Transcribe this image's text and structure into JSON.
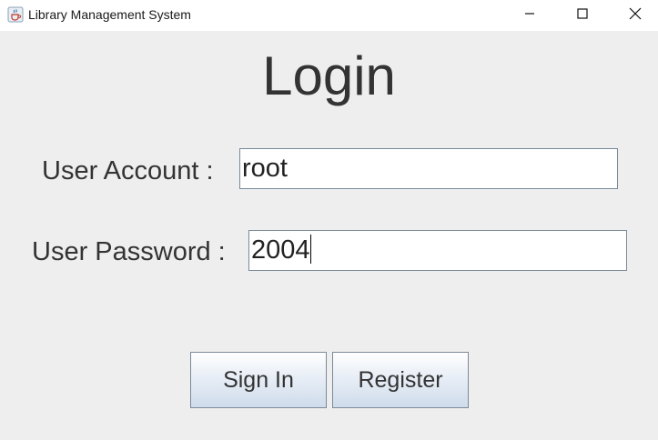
{
  "window": {
    "title": "Library Management System",
    "icons": {
      "app": "java-cup-icon",
      "minimize": "minimize-icon",
      "maximize": "maximize-icon",
      "close": "close-icon"
    }
  },
  "form": {
    "heading": "Login",
    "account_label": "User Account :",
    "account_value": "root",
    "password_label": "User Password :",
    "password_value": "2004"
  },
  "buttons": {
    "sign_in": "Sign In",
    "register": "Register"
  },
  "colors": {
    "background": "#eeeeee",
    "field_border": "#7a8a99",
    "text": "#333333"
  }
}
